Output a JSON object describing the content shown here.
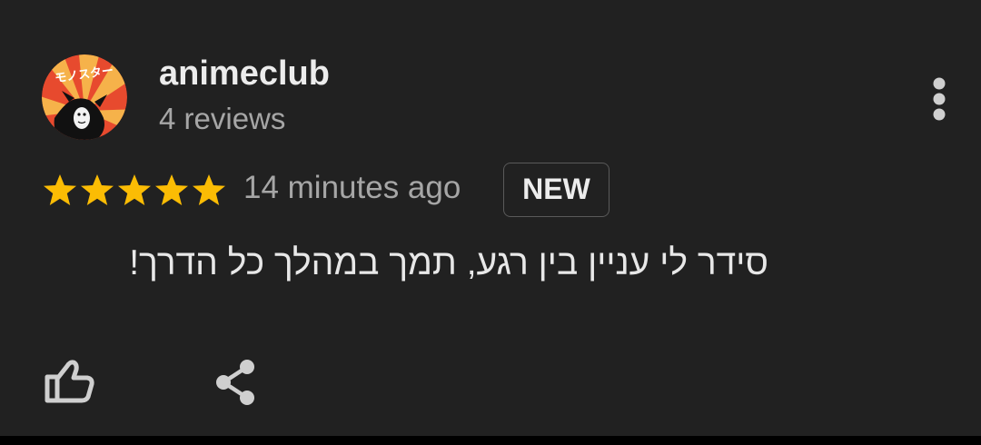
{
  "review": {
    "user_name": "animeclub",
    "review_count": "4 reviews",
    "rating": 5,
    "rating_max": 5,
    "time": "14 minutes ago",
    "badge": "NEW",
    "text": "סידר לי עניין בין רגע, תמך במהלך כל הדרך!"
  },
  "avatar": {
    "logo_text": "モノスター",
    "colors": [
      "#e74a2e",
      "#f6b24a",
      "#111111"
    ]
  },
  "icons": {
    "more": "more-vertical-icon",
    "star": "star-icon",
    "like": "thumbs-up-icon",
    "share": "share-icon"
  },
  "colors": {
    "background": "#212121",
    "star": "#fbbc04",
    "primary_text": "#ececec",
    "secondary_text": "#a6a6a6"
  }
}
